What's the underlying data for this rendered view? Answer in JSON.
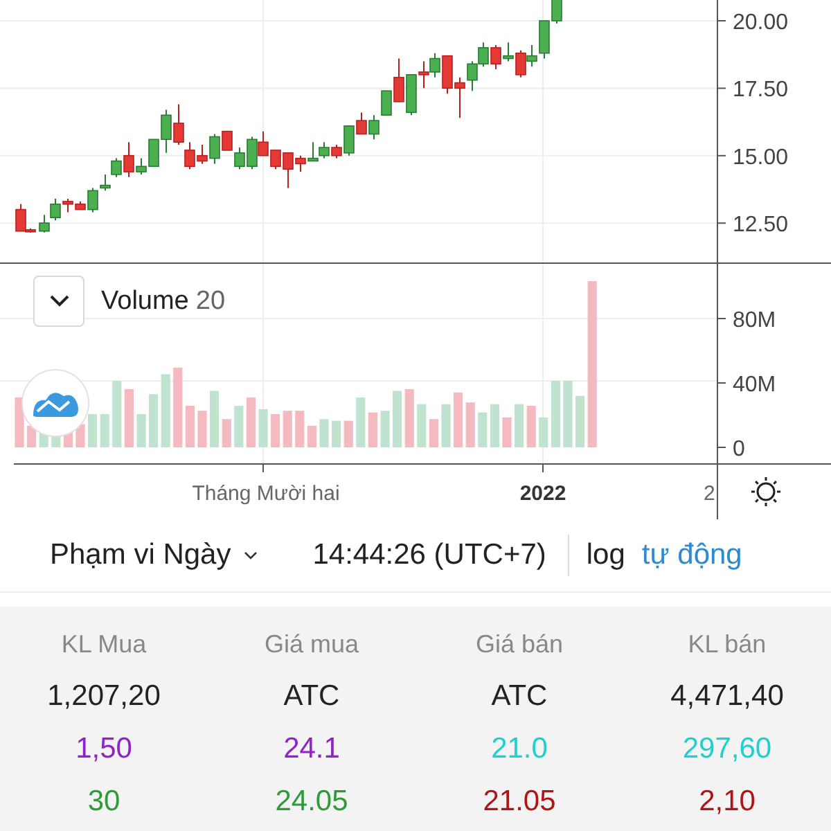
{
  "price_axis": {
    "ticks": [
      "20.00",
      "17.50",
      "15.00",
      "12.50"
    ]
  },
  "volume_pane": {
    "title": "Volume",
    "length": "20",
    "axis_ticks": [
      "80M",
      "40M",
      "0"
    ]
  },
  "time_axis": {
    "labels": [
      {
        "text": "Tháng Mười hai",
        "kind": "month"
      },
      {
        "text": "2022",
        "kind": "year"
      },
      {
        "text": "2",
        "kind": "day"
      }
    ]
  },
  "range_bar": {
    "range": "Phạm vi Ngày",
    "time": "14:44:26 (UTC+7)",
    "log": {
      "label": "log",
      "selected": false
    },
    "auto": {
      "label": "tự động",
      "selected": true
    }
  },
  "order_book": {
    "columns": [
      "KL Mua",
      "Giá mua",
      "Giá bán",
      "KL bán"
    ],
    "rows": [
      {
        "cells": [
          {
            "text": "1,207,20",
            "color": "#222222"
          },
          {
            "text": "ATC",
            "color": "#222222"
          },
          {
            "text": "ATC",
            "color": "#222222"
          },
          {
            "text": "4,471,40",
            "color": "#222222"
          }
        ]
      },
      {
        "cells": [
          {
            "text": "1,50",
            "color": "#8e24c8"
          },
          {
            "text": "24.1",
            "color": "#8e24c8"
          },
          {
            "text": "21.0",
            "color": "#1fd0d0"
          },
          {
            "text": "297,60",
            "color": "#1fd0d0"
          }
        ]
      },
      {
        "cells": [
          {
            "text": "30",
            "color": "#2e9a3a"
          },
          {
            "text": "24.05",
            "color": "#2e9a3a"
          },
          {
            "text": "21.05",
            "color": "#b01515"
          },
          {
            "text": "2,10",
            "color": "#b01515"
          }
        ]
      }
    ]
  }
}
